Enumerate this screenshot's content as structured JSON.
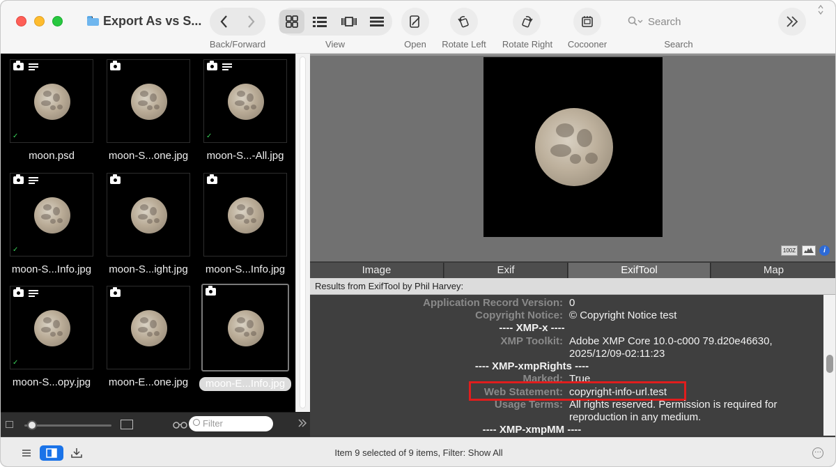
{
  "window": {
    "title": "Export As vs S..."
  },
  "toolbar": {
    "back_forward_label": "Back/Forward",
    "view_label": "View",
    "open_label": "Open",
    "rotate_left_label": "Rotate Left",
    "rotate_right_label": "Rotate Right",
    "cocooner_label": "Cocooner",
    "search_placeholder": "Search",
    "search_label": "Search"
  },
  "browser": {
    "items": [
      {
        "name": "moon.psd",
        "has_camera": true,
        "has_lines": true,
        "checked": true,
        "selected": false
      },
      {
        "name": "moon-S...one.jpg",
        "has_camera": true,
        "has_lines": false,
        "checked": false,
        "selected": false
      },
      {
        "name": "moon-S...-All.jpg",
        "has_camera": true,
        "has_lines": true,
        "checked": true,
        "selected": false
      },
      {
        "name": "moon-S...Info.jpg",
        "has_camera": true,
        "has_lines": true,
        "checked": true,
        "selected": false
      },
      {
        "name": "moon-S...ight.jpg",
        "has_camera": true,
        "has_lines": false,
        "checked": false,
        "selected": false
      },
      {
        "name": "moon-S...Info.jpg",
        "has_camera": true,
        "has_lines": false,
        "checked": false,
        "selected": false
      },
      {
        "name": "moon-S...opy.jpg",
        "has_camera": true,
        "has_lines": true,
        "checked": true,
        "selected": false
      },
      {
        "name": "moon-E...one.jpg",
        "has_camera": true,
        "has_lines": false,
        "checked": false,
        "selected": false
      },
      {
        "name": "moon-E...Info.jpg",
        "has_camera": true,
        "has_lines": false,
        "checked": false,
        "selected": true
      }
    ],
    "check_glyph": "✓",
    "filter_placeholder": "Filter"
  },
  "preview": {
    "zoom_badge": "100Z",
    "info_glyph": "i"
  },
  "tabs": [
    "Image",
    "Exif",
    "ExifTool",
    "Map"
  ],
  "active_tab": "ExifTool",
  "results_title": "Results from ExifTool by Phil Harvey:",
  "metadata": {
    "rows": [
      {
        "key": "Application Record Version:",
        "value": "0"
      },
      {
        "key": "Copyright Notice:",
        "value": "© Copyright Notice test"
      }
    ],
    "section_xmp_x": "---- XMP-x ----",
    "xmp_toolkit_key": "XMP Toolkit:",
    "xmp_toolkit_value_1": "Adobe XMP Core 10.0-c000 79.d20e46630,",
    "xmp_toolkit_value_2": "2025/12/09-02:11:23",
    "section_rights": "---- XMP-xmpRights ----",
    "marked_key": "Marked:",
    "marked_value": "True",
    "web_statement_key": "Web Statement:",
    "web_statement_value": "copyright-info-url.test",
    "usage_terms_key": "Usage Terms:",
    "usage_terms_value_1": "All rights reserved. Permission is required for",
    "usage_terms_value_2": "reproduction in any medium.",
    "section_mm": "---- XMP-xmpMM ----"
  },
  "status": {
    "text": "Item 9 selected of 9 items, Filter: Show All",
    "more_glyph": "···"
  },
  "colors": {
    "accent": "#1a73e8",
    "highlight": "#e01d1d"
  }
}
